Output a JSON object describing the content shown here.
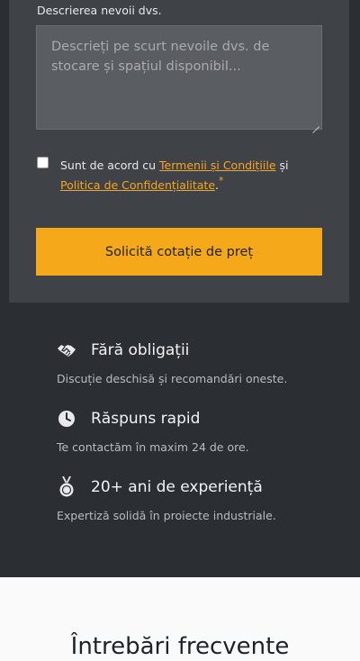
{
  "form": {
    "description_label": "Descrierea nevoii dvs.",
    "description_placeholder": "Descrieți pe scurt nevoile dvs. de stocare și spațiul disponibil...",
    "consent_prefix": "Sunt de acord cu ",
    "terms_link": "Termenii și Condițiile",
    "consent_middle": " și",
    "privacy_link": "Politica de Confidențialitate",
    "consent_suffix": ".",
    "required_mark": "*",
    "submit_label": "Solicită cotație de preț"
  },
  "features": [
    {
      "icon": "handshake-icon",
      "title": "Fără obligații",
      "description": "Discuție deschisă și recomandări oneste."
    },
    {
      "icon": "clock-icon",
      "title": "Răspuns rapid",
      "description": "Te contactăm în maxim 24 de ore."
    },
    {
      "icon": "medal-icon",
      "title": "20+ ani de experiență",
      "description": "Expertiză solidă în proiecte industriale."
    }
  ],
  "faq": {
    "title": "Întrebări frecvente"
  },
  "colors": {
    "accent": "#f5a81a",
    "dark_bg": "#2b2e33",
    "card_bg": "#3f4247",
    "light_bg": "#fafafa"
  }
}
